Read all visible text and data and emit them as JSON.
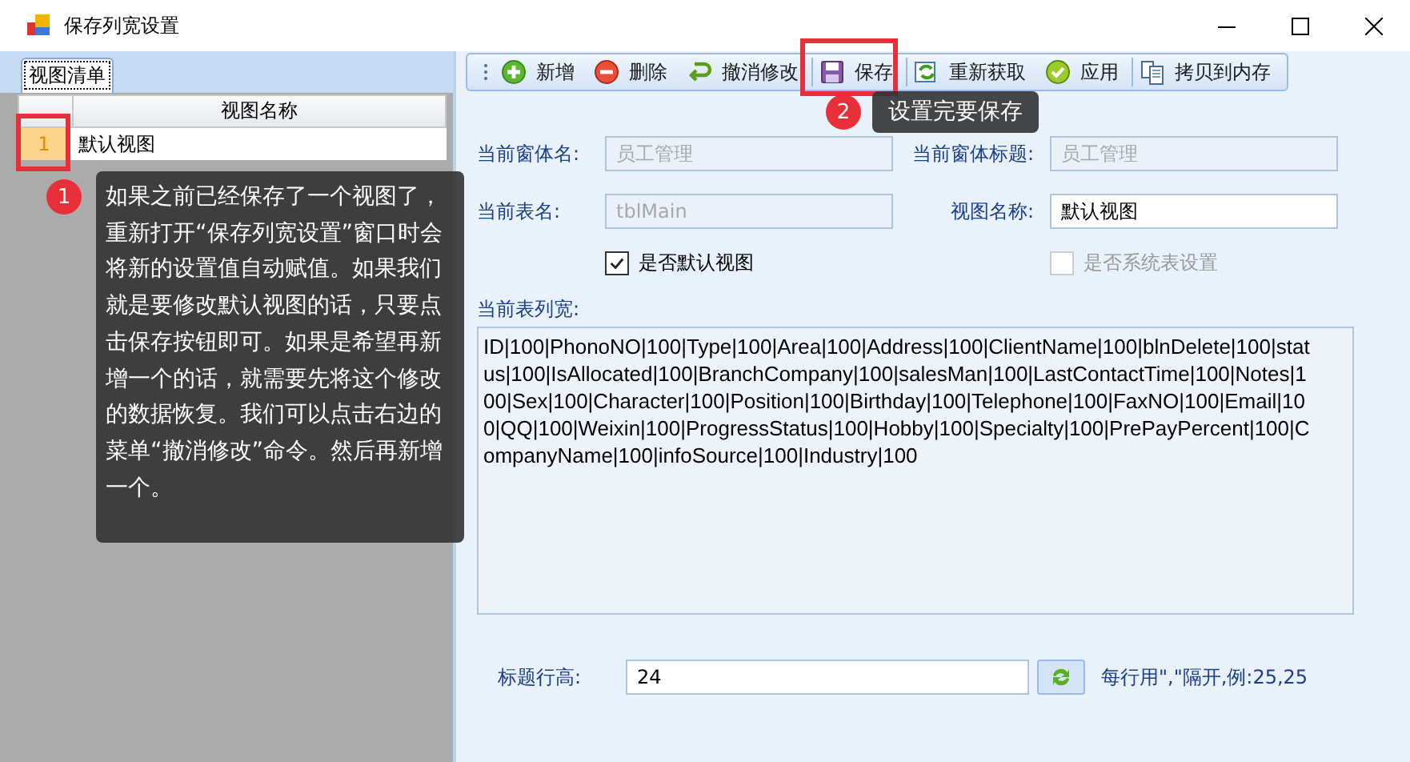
{
  "window": {
    "title": "保存列宽设置"
  },
  "left_panel": {
    "tab": {
      "label": "视图清单",
      "selected": true
    },
    "grid": {
      "columns": [
        "视图名称"
      ],
      "rows": [
        {
          "number": "1",
          "cells": [
            "默认视图"
          ],
          "selected": true
        }
      ]
    }
  },
  "toolbar": [
    {
      "label": "新增",
      "kind": "add"
    },
    {
      "label": "删除",
      "kind": "delete"
    },
    {
      "label": "撤消修改",
      "kind": "undo"
    },
    {
      "label": "保存",
      "kind": "save"
    },
    {
      "label": "重新获取",
      "kind": "refresh"
    },
    {
      "label": "应用",
      "kind": "apply"
    },
    {
      "label": "拷贝到内存",
      "kind": "copy"
    }
  ],
  "form": {
    "fields": [
      {
        "label": "当前窗体名:",
        "value": "员工管理",
        "disabled": true
      },
      {
        "label": "当前窗体标题:",
        "value": "员工管理",
        "disabled": true
      },
      {
        "label": "当前表名:",
        "value": "tblMain",
        "disabled": true
      },
      {
        "label": "视图名称:",
        "value": "默认视图",
        "disabled": false
      }
    ],
    "checkboxes": [
      {
        "label": "是否默认视图",
        "checked": true,
        "disabled": false
      },
      {
        "label": "是否系统表设置",
        "checked": false,
        "disabled": true
      }
    ],
    "column_widths": {
      "label": "当前表列宽:",
      "value": "ID|100|PhonoNO|100|Type|100|Area|100|Address|100|ClientName|100|blnDelete|100|status|100|IsAllocated|100|BranchCompany|100|salesMan|100|LastContactTime|100|Notes|100|Sex|100|Character|100|Position|100|Birthday|100|Telephone|100|FaxNO|100|Email|100|QQ|100|Weixin|100|ProgressStatus|100|Hobby|100|Specialty|100|PrePayPercent|100|CompanyName|100|infoSource|100|Industry|100"
    },
    "title_row_height": {
      "label": "标题行高:",
      "value": "24",
      "hint": "每行用\",\"隔开,例:25,25"
    }
  },
  "callouts": [
    {
      "number": "1",
      "text": "如果之前已经保存了一个视图了，重新打开“保存列宽设置”窗口时会将新的设置值自动赋值。如果我们就是要修改默认视图的话，只要点击保存按钮即可。如果是希望再新增一个的话，就需要先将这个修改的数据恢复。我们可以点击右边的菜单“撤消修改”命令。然后再新增一个。"
    },
    {
      "number": "2",
      "text": "设置完要保存"
    }
  ]
}
